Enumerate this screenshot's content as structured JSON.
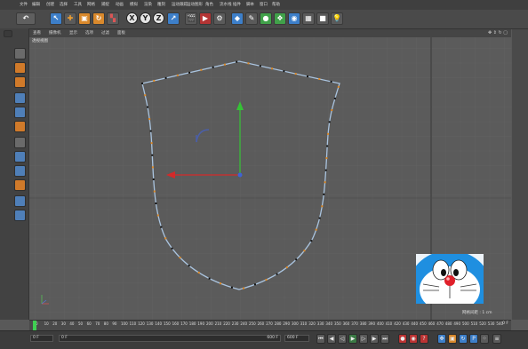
{
  "menu": {
    "items": [
      "文件",
      "编辑",
      "创建",
      "选择",
      "工具",
      "网格",
      "捕捉",
      "动画",
      "模拟",
      "渲染",
      "雕刻",
      "运动跟踪",
      "运动图形",
      "角色",
      "流水线",
      "插件",
      "脚本",
      "窗口",
      "帮助"
    ]
  },
  "toolbar": {
    "undo_icon": "undo-icon",
    "axis_x": "X",
    "axis_y": "Y",
    "axis_z": "Z"
  },
  "viewport": {
    "tabs": [
      "查看",
      "摄像机",
      "显示",
      "选项",
      "过滤",
      "面板"
    ],
    "label": "透视视图",
    "grid_spacing": "网格间距 : 1 cm",
    "colors": {
      "curve": "#aac4df",
      "point": "#e08a25",
      "x_axis": "#d42a2a",
      "y_axis": "#35c235",
      "center": "#3f63d6"
    }
  },
  "timeline": {
    "ticks": [
      "0",
      "10",
      "20",
      "30",
      "40",
      "50",
      "60",
      "70",
      "80",
      "90",
      "100",
      "110",
      "120",
      "130",
      "140",
      "150",
      "160",
      "170",
      "180",
      "190",
      "200",
      "210",
      "220",
      "230",
      "240",
      "250",
      "260",
      "270",
      "280",
      "290",
      "300",
      "310",
      "320",
      "330",
      "340",
      "350",
      "360",
      "370",
      "380",
      "390",
      "400",
      "410",
      "420",
      "430",
      "440",
      "450",
      "460",
      "470",
      "480",
      "490",
      "500",
      "510",
      "520",
      "530",
      "540"
    ],
    "end_label": "0 F"
  },
  "controls": {
    "current_frame": "0 F",
    "start_frame": "0 F",
    "end_frame": "600 F",
    "preview_end": "600 F"
  }
}
